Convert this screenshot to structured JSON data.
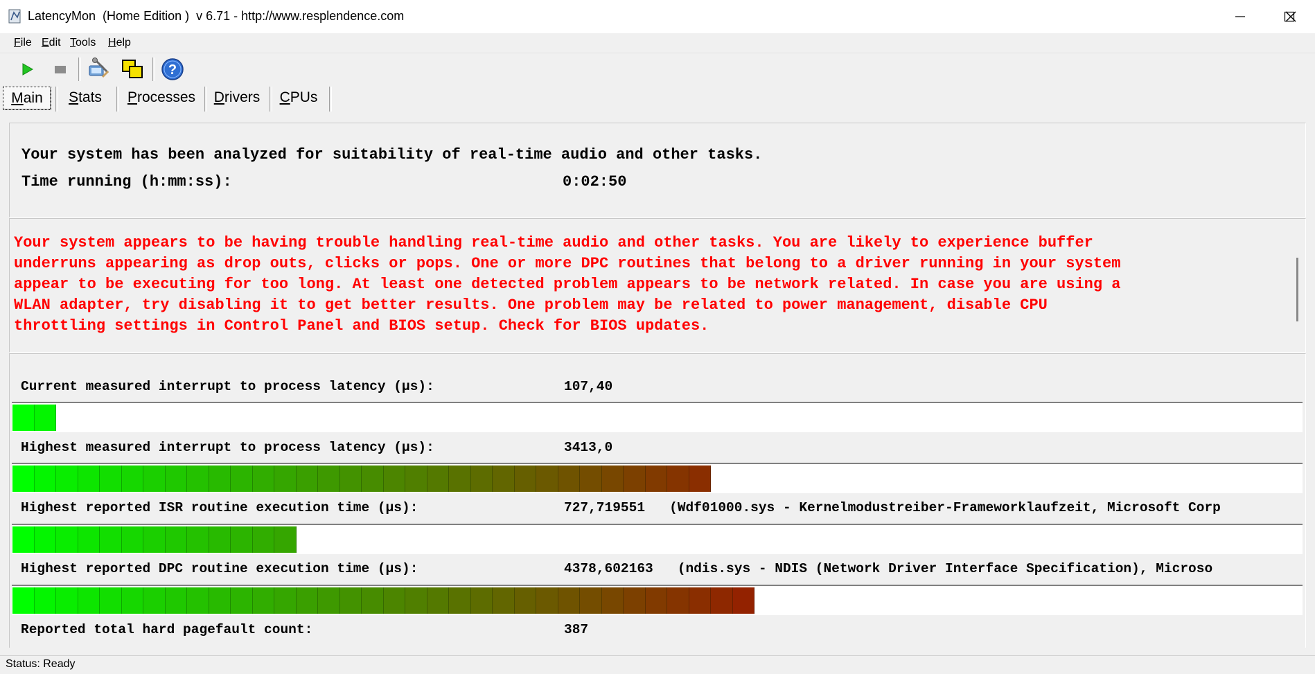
{
  "window": {
    "title": "LatencyMon  (Home Edition )  v 6.71 - http://www.resplendence.com",
    "controls": [
      "minimize",
      "maximize",
      "close"
    ]
  },
  "menu": {
    "file": {
      "mnemonic": "F",
      "rest": "ile"
    },
    "edit": {
      "mnemonic": "E",
      "rest": "dit"
    },
    "tools": {
      "mnemonic": "T",
      "rest": "ools"
    },
    "help": {
      "mnemonic": "H",
      "rest": "elp"
    }
  },
  "toolbar": {
    "buttons": [
      "play-icon",
      "stop-icon",
      "tools-icon",
      "windows-icon",
      "help-icon"
    ]
  },
  "tabs": [
    {
      "mnemonic": "M",
      "rest": "ain"
    },
    {
      "mnemonic": "S",
      "rest": "tats"
    },
    {
      "mnemonic": "P",
      "rest": "rocesses"
    },
    {
      "mnemonic": "D",
      "rest": "rivers"
    },
    {
      "mnemonic": "C",
      "rest": "PUs"
    }
  ],
  "summary": {
    "analyzed": "Your system has been analyzed for suitability of real-time audio and other tasks.",
    "time_label": "Time running (h:mm:ss):",
    "time_value": "0:02:50"
  },
  "warning": {
    "text": "Your system appears to be having trouble handling real-time audio and other tasks. You are likely to experience buffer\nunderruns appearing as drop outs, clicks or pops. One or more DPC routines that belong to a driver running in your system\nappear to be executing for too long. At least one detected problem appears to be network related. In case you are using a\nWLAN adapter, try disabling it to get better results. One problem may be related to power management, disable CPU\nthrottling settings in Control Panel and BIOS setup. Check for BIOS updates.",
    "color": "#ff0000"
  },
  "metrics": {
    "current_latency": {
      "label": "Current measured interrupt to process latency (µs):",
      "value": "107,40",
      "segments": 2,
      "partial": 0
    },
    "highest_latency": {
      "label": "Highest measured interrupt to process latency (µs):",
      "value": "3413,0",
      "segments": 32,
      "partial": 0
    },
    "isr": {
      "label": "Highest reported ISR routine execution time (µs):",
      "value": "727,719551   (Wdf01000.sys - Kernelmodustreiber-Frameworklaufzeit, Microsoft Corp",
      "segments": 13,
      "partial": 0
    },
    "dpc": {
      "label": "Highest reported DPC routine execution time (µs):",
      "value": "4378,602163   (ndis.sys - NDIS (Network Driver Interface Specification), Microso",
      "segments": 34,
      "partial": 0
    },
    "pagefault": {
      "label": "Reported total hard pagefault count:",
      "value": "387"
    }
  },
  "colors": {
    "bar_start": "#00ff00",
    "bar_end": "#a01000"
  },
  "status": {
    "text": "Status: Ready"
  }
}
